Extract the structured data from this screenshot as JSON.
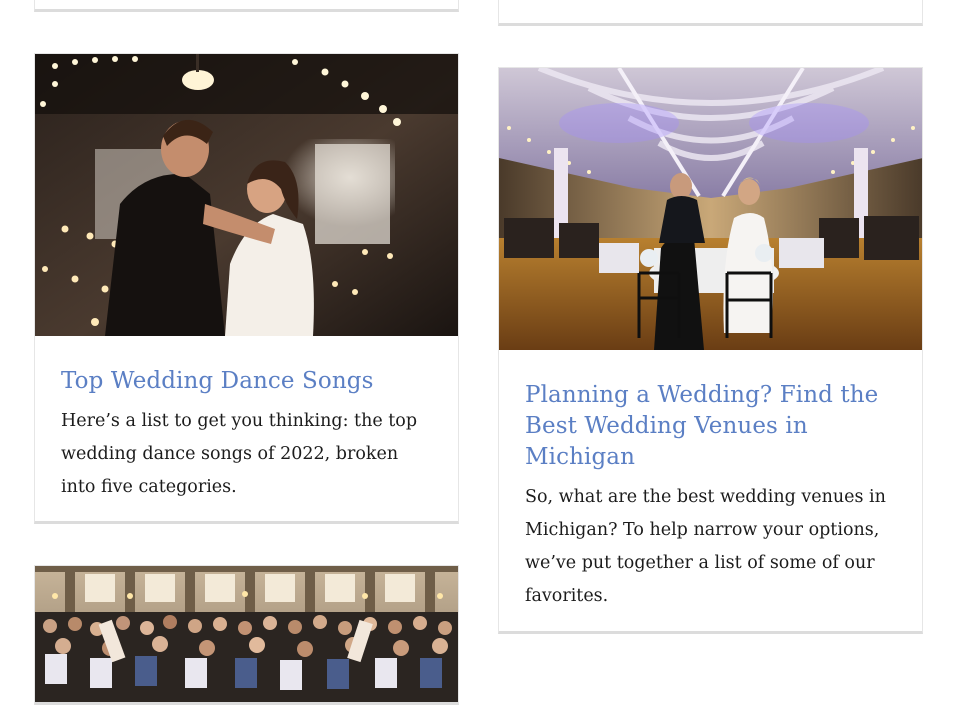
{
  "posts": [
    {
      "title": "Top Wedding Dance Songs",
      "excerpt": "Here’s a list to get you thinking: the top wedding dance songs of 2022, broken into five categories.",
      "image_subject": "couple-dancing-photo"
    },
    {
      "title": "Planning a Wedding? Find the Best Wedding Venues in Michigan",
      "excerpt": "So, what are the best wedding venues in Michigan? To help narrow your options, we’ve put together a list of some of our favorites.",
      "image_subject": "ballroom-venue-photo"
    },
    {
      "title": "",
      "excerpt": "",
      "image_subject": "crowded-reception-photo"
    }
  ],
  "colors": {
    "title": "#5b7fc4",
    "text": "#1c1c1c",
    "card_border": "#dcdcdc"
  }
}
